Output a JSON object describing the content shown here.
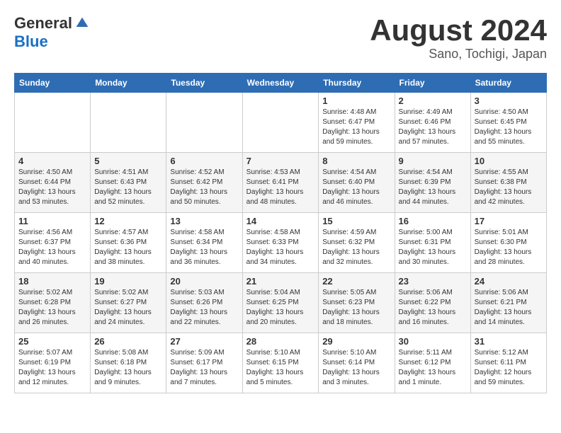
{
  "logo": {
    "general": "General",
    "blue": "Blue"
  },
  "title": {
    "month_year": "August 2024",
    "location": "Sano, Tochigi, Japan"
  },
  "days_of_week": [
    "Sunday",
    "Monday",
    "Tuesday",
    "Wednesday",
    "Thursday",
    "Friday",
    "Saturday"
  ],
  "weeks": [
    [
      {
        "day": "",
        "info": ""
      },
      {
        "day": "",
        "info": ""
      },
      {
        "day": "",
        "info": ""
      },
      {
        "day": "",
        "info": ""
      },
      {
        "day": "1",
        "info": "Sunrise: 4:48 AM\nSunset: 6:47 PM\nDaylight: 13 hours\nand 59 minutes."
      },
      {
        "day": "2",
        "info": "Sunrise: 4:49 AM\nSunset: 6:46 PM\nDaylight: 13 hours\nand 57 minutes."
      },
      {
        "day": "3",
        "info": "Sunrise: 4:50 AM\nSunset: 6:45 PM\nDaylight: 13 hours\nand 55 minutes."
      }
    ],
    [
      {
        "day": "4",
        "info": "Sunrise: 4:50 AM\nSunset: 6:44 PM\nDaylight: 13 hours\nand 53 minutes."
      },
      {
        "day": "5",
        "info": "Sunrise: 4:51 AM\nSunset: 6:43 PM\nDaylight: 13 hours\nand 52 minutes."
      },
      {
        "day": "6",
        "info": "Sunrise: 4:52 AM\nSunset: 6:42 PM\nDaylight: 13 hours\nand 50 minutes."
      },
      {
        "day": "7",
        "info": "Sunrise: 4:53 AM\nSunset: 6:41 PM\nDaylight: 13 hours\nand 48 minutes."
      },
      {
        "day": "8",
        "info": "Sunrise: 4:54 AM\nSunset: 6:40 PM\nDaylight: 13 hours\nand 46 minutes."
      },
      {
        "day": "9",
        "info": "Sunrise: 4:54 AM\nSunset: 6:39 PM\nDaylight: 13 hours\nand 44 minutes."
      },
      {
        "day": "10",
        "info": "Sunrise: 4:55 AM\nSunset: 6:38 PM\nDaylight: 13 hours\nand 42 minutes."
      }
    ],
    [
      {
        "day": "11",
        "info": "Sunrise: 4:56 AM\nSunset: 6:37 PM\nDaylight: 13 hours\nand 40 minutes."
      },
      {
        "day": "12",
        "info": "Sunrise: 4:57 AM\nSunset: 6:36 PM\nDaylight: 13 hours\nand 38 minutes."
      },
      {
        "day": "13",
        "info": "Sunrise: 4:58 AM\nSunset: 6:34 PM\nDaylight: 13 hours\nand 36 minutes."
      },
      {
        "day": "14",
        "info": "Sunrise: 4:58 AM\nSunset: 6:33 PM\nDaylight: 13 hours\nand 34 minutes."
      },
      {
        "day": "15",
        "info": "Sunrise: 4:59 AM\nSunset: 6:32 PM\nDaylight: 13 hours\nand 32 minutes."
      },
      {
        "day": "16",
        "info": "Sunrise: 5:00 AM\nSunset: 6:31 PM\nDaylight: 13 hours\nand 30 minutes."
      },
      {
        "day": "17",
        "info": "Sunrise: 5:01 AM\nSunset: 6:30 PM\nDaylight: 13 hours\nand 28 minutes."
      }
    ],
    [
      {
        "day": "18",
        "info": "Sunrise: 5:02 AM\nSunset: 6:28 PM\nDaylight: 13 hours\nand 26 minutes."
      },
      {
        "day": "19",
        "info": "Sunrise: 5:02 AM\nSunset: 6:27 PM\nDaylight: 13 hours\nand 24 minutes."
      },
      {
        "day": "20",
        "info": "Sunrise: 5:03 AM\nSunset: 6:26 PM\nDaylight: 13 hours\nand 22 minutes."
      },
      {
        "day": "21",
        "info": "Sunrise: 5:04 AM\nSunset: 6:25 PM\nDaylight: 13 hours\nand 20 minutes."
      },
      {
        "day": "22",
        "info": "Sunrise: 5:05 AM\nSunset: 6:23 PM\nDaylight: 13 hours\nand 18 minutes."
      },
      {
        "day": "23",
        "info": "Sunrise: 5:06 AM\nSunset: 6:22 PM\nDaylight: 13 hours\nand 16 minutes."
      },
      {
        "day": "24",
        "info": "Sunrise: 5:06 AM\nSunset: 6:21 PM\nDaylight: 13 hours\nand 14 minutes."
      }
    ],
    [
      {
        "day": "25",
        "info": "Sunrise: 5:07 AM\nSunset: 6:19 PM\nDaylight: 13 hours\nand 12 minutes."
      },
      {
        "day": "26",
        "info": "Sunrise: 5:08 AM\nSunset: 6:18 PM\nDaylight: 13 hours\nand 9 minutes."
      },
      {
        "day": "27",
        "info": "Sunrise: 5:09 AM\nSunset: 6:17 PM\nDaylight: 13 hours\nand 7 minutes."
      },
      {
        "day": "28",
        "info": "Sunrise: 5:10 AM\nSunset: 6:15 PM\nDaylight: 13 hours\nand 5 minutes."
      },
      {
        "day": "29",
        "info": "Sunrise: 5:10 AM\nSunset: 6:14 PM\nDaylight: 13 hours\nand 3 minutes."
      },
      {
        "day": "30",
        "info": "Sunrise: 5:11 AM\nSunset: 6:12 PM\nDaylight: 13 hours\nand 1 minute."
      },
      {
        "day": "31",
        "info": "Sunrise: 5:12 AM\nSunset: 6:11 PM\nDaylight: 12 hours\nand 59 minutes."
      }
    ]
  ]
}
